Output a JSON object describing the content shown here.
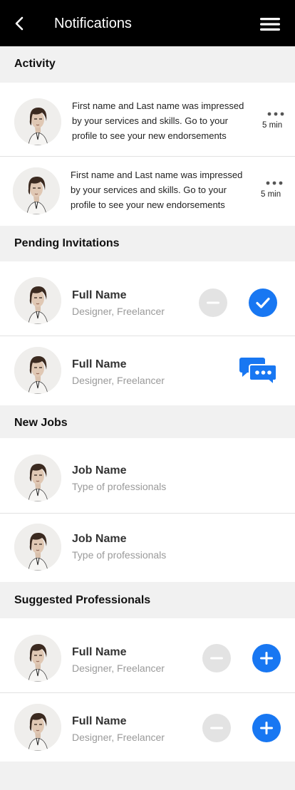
{
  "header": {
    "title": "Notifications"
  },
  "sections": {
    "activity": "Activity",
    "pending": "Pending Invitations",
    "jobs": "New Jobs",
    "suggested": "Suggested Professionals"
  },
  "activity": [
    {
      "line1": "First name and Last name was impressed",
      "line2": "by your services and skills. Go to your",
      "line3": "profile to see your new endorsements",
      "time": "5 min"
    },
    {
      "line1": "First name and Last name was impressed",
      "line2": "by your services and skills. Go to your",
      "line3": "profile to see your new endorsements",
      "time": "5 min"
    }
  ],
  "pending": [
    {
      "name": "Full Name",
      "role": "Designer, Freelancer"
    },
    {
      "name": "Full Name",
      "role": "Designer, Freelancer"
    }
  ],
  "jobs": [
    {
      "name": "Job Name",
      "type": "Type of professionals"
    },
    {
      "name": "Job Name",
      "type": "Type of professionals"
    }
  ],
  "suggested": [
    {
      "name": "Full Name",
      "role": "Designer, Freelancer"
    },
    {
      "name": "Full Name",
      "role": "Designer, Freelancer"
    }
  ],
  "colors": {
    "topbar": "#000000",
    "accent": "#1877f2",
    "neutral_button": "#e3e3e3",
    "background": "#f1f1f1"
  },
  "icons": {
    "back": "chevron-left-icon",
    "menu": "hamburger-menu-icon",
    "more": "more-horizontal-icon",
    "decline": "minus-icon",
    "accept": "check-icon",
    "chat": "chat-bubbles-icon",
    "add": "plus-icon"
  }
}
